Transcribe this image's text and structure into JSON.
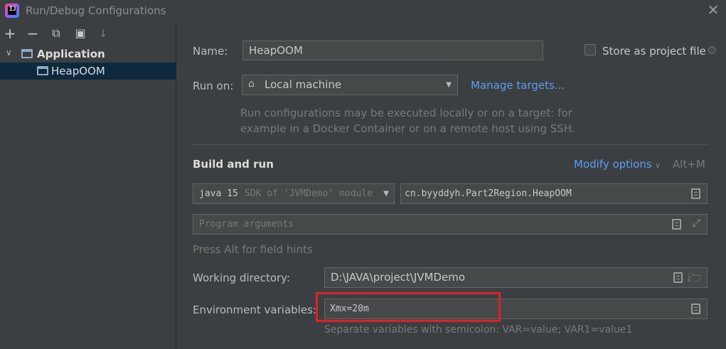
{
  "window": {
    "title": "Run/Debug Configurations",
    "app_icon_text": "IJ"
  },
  "toolbar": {
    "add": "+",
    "remove": "−",
    "copy": "⧉",
    "new_folder": "▣",
    "sort": "↓"
  },
  "tree": {
    "group_label": "Application",
    "item_label": "HeapOOM"
  },
  "form": {
    "name_label": "Name:",
    "name_value": "HeapOOM",
    "store_label": "Store as project file",
    "run_on_label": "Run on:",
    "run_on_value": "Local machine",
    "manage_targets": "Manage targets...",
    "run_on_help_line1": "Run configurations may be executed locally or on a target: for",
    "run_on_help_line2": "example in a Docker Container or on a remote host using SSH.",
    "build_section": "Build and run",
    "modify_options": "Modify options",
    "modify_shortcut": "Alt+M",
    "jdk_version": "java 15",
    "jdk_detail": "SDK of 'JVMDemo' module",
    "main_class": "cn.byyddyh.Part2Region.HeapOOM",
    "program_args_placeholder": "Program arguments",
    "field_hints": "Press Alt for field hints",
    "working_dir_label": "Working directory:",
    "working_dir_value": "D:\\JAVA\\project\\JVMDemo",
    "env_label": "Environment variables:",
    "env_value": "Xmx=20m",
    "env_help": "Separate variables with semicolon: VAR=value; VAR1=value1"
  },
  "colors": {
    "accent_link": "#589df6",
    "highlight_box": "#e0202a",
    "selection": "#0d293e"
  }
}
